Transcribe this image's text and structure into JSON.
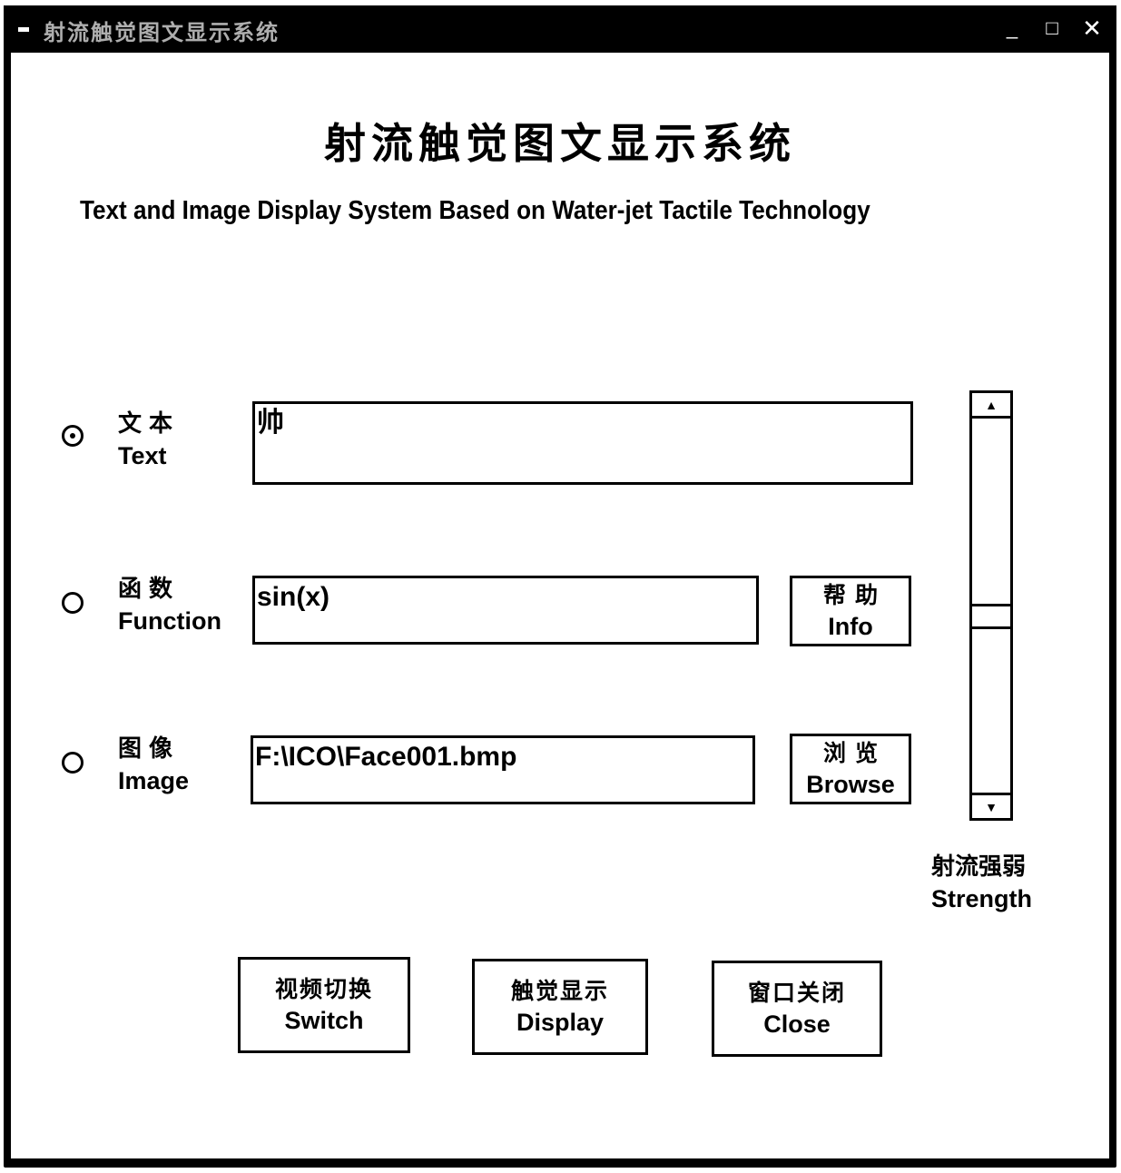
{
  "window": {
    "title": "射流触觉图文显示系统",
    "controls": {
      "minimize": "_",
      "maximize": "□",
      "close": "✕"
    }
  },
  "header": {
    "title_zh": "射流触觉图文显示系统",
    "title_en": "Text and Image Display System Based on Water-jet Tactile Technology"
  },
  "modes": [
    {
      "id": "text",
      "label_zh": "文本",
      "label_en": "Text",
      "selected": true,
      "value": "帅"
    },
    {
      "id": "function",
      "label_zh": "函数",
      "label_en": "Function",
      "selected": false,
      "value": "sin(x)"
    },
    {
      "id": "image",
      "label_zh": "图像",
      "label_en": "Image",
      "selected": false,
      "value": "F:\\ICO\\Face001.bmp"
    }
  ],
  "side_buttons": {
    "info": {
      "label_zh": "帮助",
      "label_en": "Info"
    },
    "browse": {
      "label_zh": "浏览",
      "label_en": "Browse"
    }
  },
  "strength": {
    "label_zh": "射流强弱",
    "label_en": "Strength",
    "value_fraction": 0.53,
    "up_icon": "▲",
    "down_icon": "▼"
  },
  "bottom_buttons": [
    {
      "id": "switch",
      "label_zh": "视频切换",
      "label_en": "Switch"
    },
    {
      "id": "display",
      "label_zh": "触觉显示",
      "label_en": "Display"
    },
    {
      "id": "close",
      "label_zh": "窗口关闭",
      "label_en": "Close"
    }
  ]
}
